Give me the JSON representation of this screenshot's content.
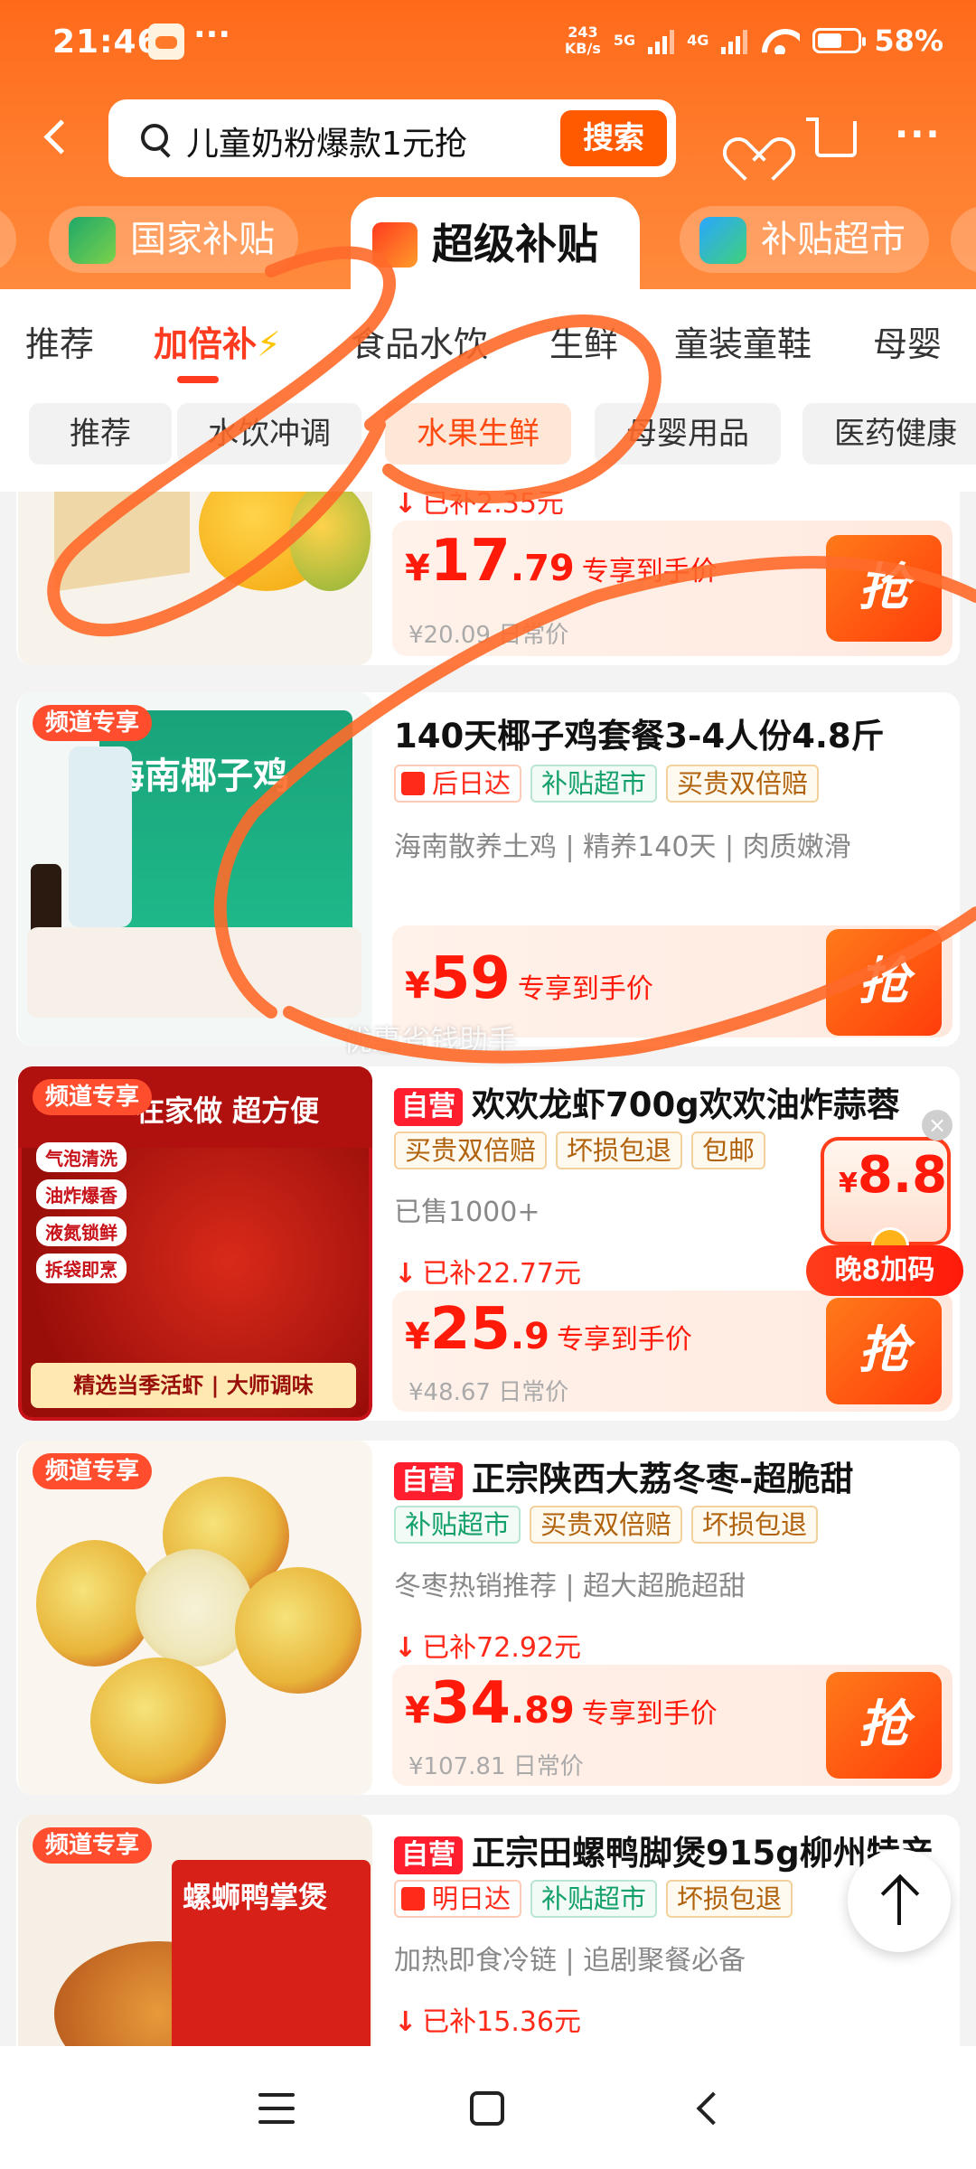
{
  "status_bar": {
    "time": "21:46",
    "net_speed_top": "243",
    "net_speed_bottom": "KB/s",
    "sim1": "5G",
    "sim2": "4G",
    "battery": "58%"
  },
  "search": {
    "query": "儿童奶粉爆款1元抢",
    "button": "搜索"
  },
  "channels": {
    "left": "国家补贴",
    "selected": "超级补贴",
    "right": "补贴超市"
  },
  "categories": [
    "推荐",
    "加倍补",
    "食品水饮",
    "生鲜",
    "童装童鞋",
    "母婴"
  ],
  "category_bolt": "⚡",
  "subcategories": [
    "推荐",
    "水饮冲调",
    "水果生鲜",
    "母婴用品",
    "医药健康"
  ],
  "products": [
    {
      "subsidy": "已补2.35元",
      "price_int": "17",
      "price_dec": ".79",
      "price_label": "专享到手价",
      "orig": "¥20.09 日常价",
      "button": "抢"
    },
    {
      "badge": "频道专享",
      "title": "140天椰子鸡套餐3-4人份4.8斤",
      "tags": [
        "后日达",
        "补贴超市",
        "买贵双倍赔"
      ],
      "desc": "海南散养土鸡 | 精养140天 | 肉质嫩滑",
      "price_int": "59",
      "price_dec": "",
      "price_label": "专享到手价",
      "button": "抢",
      "thumb_text": "海南椰子鸡"
    },
    {
      "badge": "频道专享",
      "ziying": "自营",
      "title": "欢欢龙虾700g欢欢油炸蒜蓉",
      "tags": [
        "买贵双倍赔",
        "坏损包退",
        "包邮"
      ],
      "desc": "已售1000+",
      "subsidy": "已补22.77元",
      "price_int": "25",
      "price_dec": ".9",
      "price_label": "专享到手价",
      "orig": "¥48.67 日常价",
      "button": "抢",
      "thumb_head": "在家做 超方便",
      "thumb_points": [
        "气泡清洗",
        "油炸爆香",
        "液氮锁鲜",
        "拆袋即烹"
      ],
      "thumb_foot": "精选当季活虾 | 大师调味"
    },
    {
      "badge": "频道专享",
      "ziying": "自营",
      "title": "正宗陕西大荔冬枣-超脆甜",
      "tags": [
        "补贴超市",
        "买贵双倍赔",
        "坏损包退"
      ],
      "desc": "冬枣热销推荐 | 超大超脆超甜",
      "subsidy": "已补72.92元",
      "price_int": "34",
      "price_dec": ".89",
      "price_label": "专享到手价",
      "orig": "¥107.81 日常价",
      "button": "抢"
    },
    {
      "badge": "频道专享",
      "ziying": "自营",
      "title": "正宗田螺鸭脚煲915g柳州特产",
      "tags": [
        "明日达",
        "补贴超市",
        "坏损包退"
      ],
      "desc": "加热即食冷链 | 追剧聚餐必备",
      "subsidy": "已补15.36元",
      "thumb_text": "螺蛳鸭掌煲"
    }
  ],
  "promo": {
    "yen": "¥",
    "price": "8.8",
    "label": "晚8加码"
  },
  "watermark": "优惠省钱助手",
  "colors": {
    "brand_orange": "#ff6a1a",
    "price_red": "#ff1a0a",
    "accent_green": "#14a06a"
  }
}
